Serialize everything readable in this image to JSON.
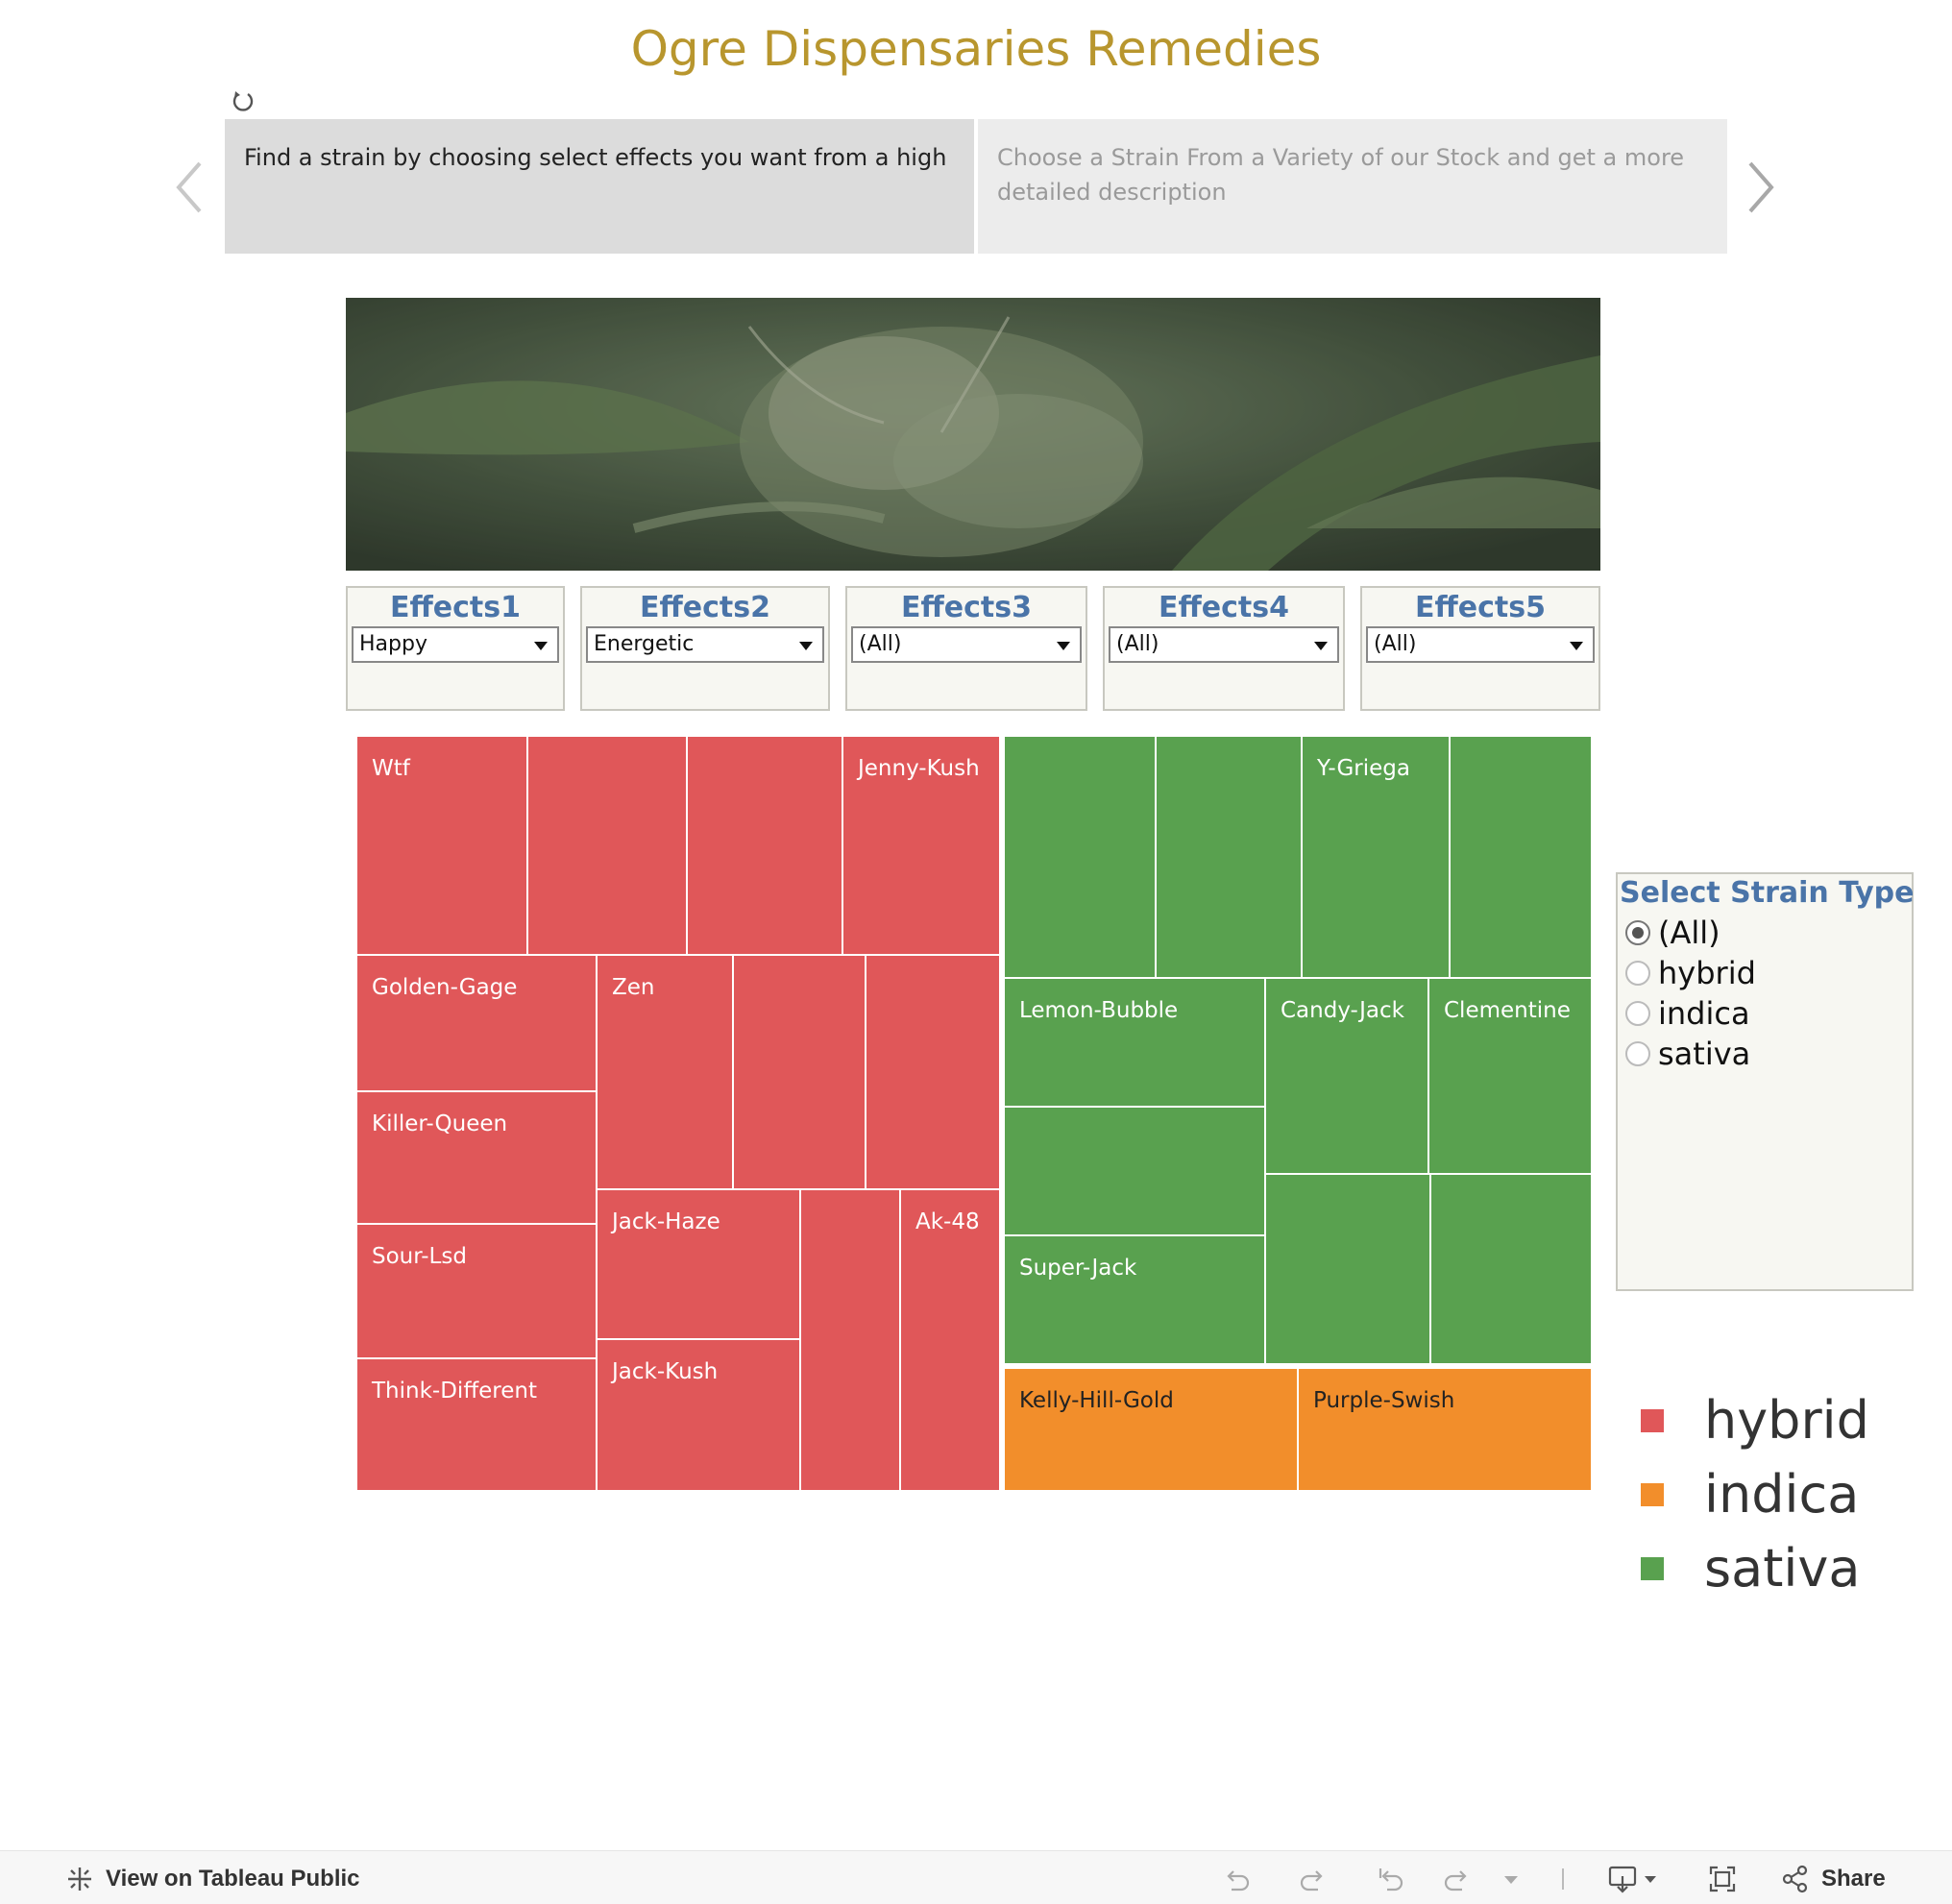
{
  "title": "Ogre Dispensaries Remedies",
  "story": {
    "points": [
      "Find a strain by choosing select effects you want from a high",
      "Choose a Strain From a Variety of our Stock and get a more detailed description"
    ]
  },
  "filters": [
    {
      "label": "Effects1",
      "value": "Happy"
    },
    {
      "label": "Effects2",
      "value": "Energetic"
    },
    {
      "label": "Effects3",
      "value": "(All)"
    },
    {
      "label": "Effects4",
      "value": "(All)"
    },
    {
      "label": "Effects5",
      "value": "(All)"
    }
  ],
  "strain_filter": {
    "label": "Select Strain Type",
    "options": [
      "(All)",
      "hybrid",
      "indica",
      "sativa"
    ],
    "selected": "(All)"
  },
  "legend": [
    {
      "label": "hybrid",
      "color": "#e05759"
    },
    {
      "label": "indica",
      "color": "#f28e2b"
    },
    {
      "label": "sativa",
      "color": "#59a14f"
    }
  ],
  "treemap_labels": {
    "wtf": "Wtf",
    "jenny_kush": "Jenny-Kush",
    "golden_gage": "Golden-Gage",
    "zen": "Zen",
    "killer_queen": "Killer-Queen",
    "jack_haze": "Jack-Haze",
    "ak_48": "Ak-48",
    "sour_lsd": "Sour-Lsd",
    "jack_kush": "Jack-Kush",
    "think_different": "Think-Different",
    "y_griega": "Y-Griega",
    "lemon_bubble": "Lemon-Bubble",
    "candy_jack": "Candy-Jack",
    "clementine": "Clementine",
    "super_jack": "Super-Jack",
    "kelly_hill_gold": "Kelly-Hill-Gold",
    "purple_swish": "Purple-Swish"
  },
  "toolbar": {
    "view_label": "View on Tableau Public",
    "share_label": "Share"
  }
}
